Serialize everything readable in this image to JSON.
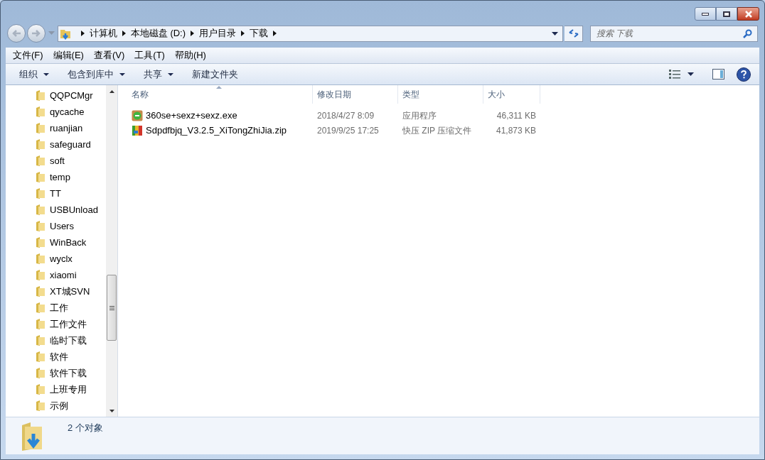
{
  "address": {
    "crumbs": [
      "计算机",
      "本地磁盘 (D:)",
      "用户目录",
      "下载"
    ]
  },
  "search": {
    "placeholder": "搜索 下载"
  },
  "menu": [
    "文件(F)",
    "编辑(E)",
    "查看(V)",
    "工具(T)",
    "帮助(H)"
  ],
  "toolbar": [
    {
      "label": "组织",
      "dropdown": true
    },
    {
      "label": "包含到库中",
      "dropdown": true
    },
    {
      "label": "共享",
      "dropdown": true
    },
    {
      "label": "新建文件夹",
      "dropdown": false
    }
  ],
  "sidebar": {
    "items": [
      {
        "label": "QQPCMgr"
      },
      {
        "label": "qycache"
      },
      {
        "label": "ruanjian"
      },
      {
        "label": "safeguard"
      },
      {
        "label": "soft"
      },
      {
        "label": "temp"
      },
      {
        "label": "TT"
      },
      {
        "label": "USBUnload"
      },
      {
        "label": "Users"
      },
      {
        "label": "WinBack"
      },
      {
        "label": "wyclx"
      },
      {
        "label": "xiaomi"
      },
      {
        "label": "XT城SVN"
      },
      {
        "label": "工作"
      },
      {
        "label": "工作文件"
      },
      {
        "label": "临时下载"
      },
      {
        "label": "软件"
      },
      {
        "label": "软件下载"
      },
      {
        "label": "上班专用"
      },
      {
        "label": "示例"
      }
    ]
  },
  "table": {
    "columns": [
      "名称",
      "修改日期",
      "类型",
      "大小"
    ],
    "rows": [
      {
        "kind": "exe",
        "name": "360se+sexz+sexz.exe",
        "date": "2018/4/27 8:09",
        "type": "应用程序",
        "size": "46,311 KB"
      },
      {
        "kind": "zip",
        "name": "Sdpdfbjq_V3.2.5_XiTongZhiJia.zip",
        "date": "2019/9/25 17:25",
        "type": "快压 ZIP 压缩文件",
        "size": "41,873 KB"
      }
    ]
  },
  "status_bar": {
    "text": "2 个对象"
  }
}
